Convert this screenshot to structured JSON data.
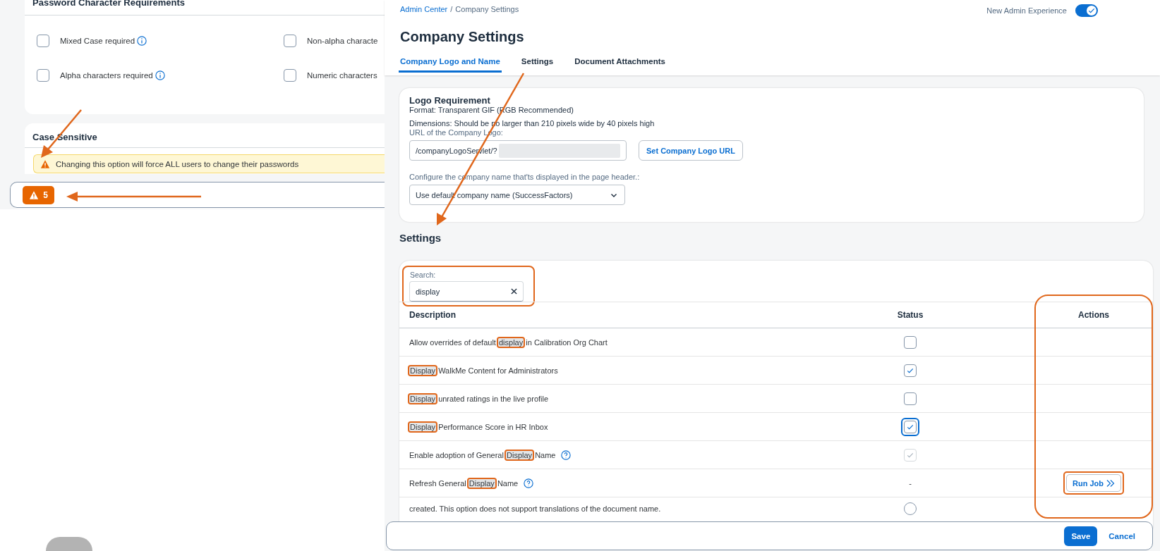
{
  "left_panel": {
    "password_requirements": {
      "title": "Password Character Requirements",
      "options": [
        {
          "label": "Mixed Case required",
          "checked": false,
          "info": true
        },
        {
          "label": "Non-alpha characte",
          "checked": false
        },
        {
          "label": "Alpha characters required",
          "checked": false,
          "info": true
        },
        {
          "label": "Numeric characters",
          "checked": false
        }
      ]
    },
    "case_sensitive": {
      "title": "Case Sensitive",
      "warning": "Changing this option will force ALL users to change their passwords"
    },
    "footer": {
      "warning_count": "5"
    }
  },
  "header": {
    "breadcrumb": {
      "link": "Admin Center",
      "separator": "/",
      "current": "Company Settings"
    },
    "toggle": {
      "label": "New Admin Experience",
      "on": true
    },
    "title": "Company Settings",
    "tabs": [
      {
        "label": "Company Logo and Name",
        "selected": true
      },
      {
        "label": "Settings",
        "selected": false
      },
      {
        "label": "Document Attachments",
        "selected": false
      }
    ]
  },
  "logo_card": {
    "title": "Logo Requirement",
    "format": "Format: Transparent GIF (RGB Recommended)",
    "dimensions": "Dimensions: Should be no larger than 210 pixels wide by 40 pixels high",
    "url_label": "URL of the Company Logo:",
    "url_value": "/companyLogoServlet/?",
    "set_button": "Set Company Logo URL",
    "name_label": "Configure the company name that'ts displayed in the page header.:",
    "name_select": "Use default company name (SuccessFactors)"
  },
  "settings": {
    "title": "Settings",
    "search": {
      "label": "Search:",
      "value": "display"
    },
    "columns": [
      "Description",
      "Status",
      "Actions"
    ],
    "rows": [
      {
        "description": {
          "before": "Allow overrides of default ",
          "match": "display",
          "after": " in Calibration Org Chart"
        },
        "kind": "checkbox",
        "checked": false,
        "disabled": false
      },
      {
        "description": {
          "match": "Display",
          "after": " WalkMe Content for Administrators"
        },
        "kind": "checkbox",
        "checked": true,
        "disabled": false
      },
      {
        "description": {
          "match": "Display",
          "after": " unrated ratings in the live profile"
        },
        "kind": "checkbox",
        "checked": false,
        "disabled": false
      },
      {
        "description": {
          "match": "Display",
          "after": " Performance Score in HR Inbox"
        },
        "kind": "checkbox",
        "checked": true,
        "disabled": false,
        "focused": true
      },
      {
        "description": {
          "before": "Enable adoption of General ",
          "match": "Display",
          "after": " Name"
        },
        "kind": "checkbox",
        "checked": true,
        "disabled": true,
        "help": true
      },
      {
        "description": {
          "before": "Refresh General ",
          "match": "Display",
          "after": " Name"
        },
        "kind": "text",
        "status": "-",
        "help": true,
        "action": "Run Job"
      },
      {
        "description": {
          "before": "created. This option does not support translations of the document name."
        },
        "kind": "radio",
        "checked": false,
        "disabled": false
      }
    ]
  },
  "footer": {
    "buttons": [
      {
        "label": "Save",
        "kind": "primary"
      },
      {
        "label": "Cancel",
        "kind": "text"
      }
    ]
  }
}
